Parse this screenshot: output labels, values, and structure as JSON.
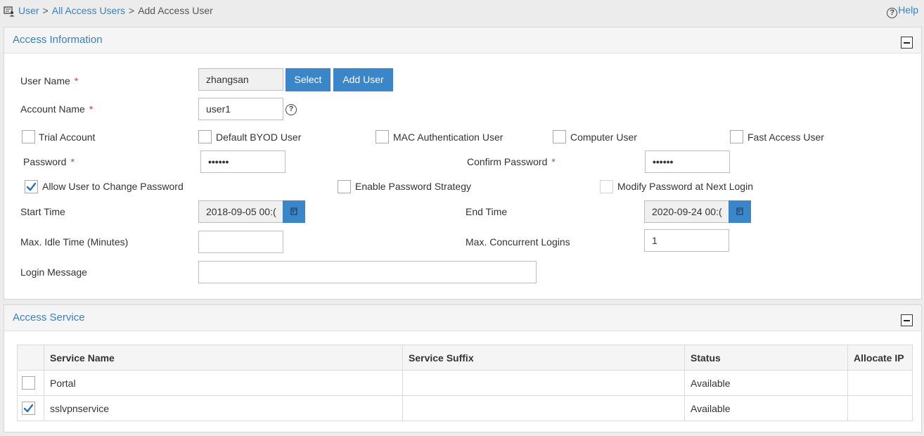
{
  "breadcrumb": {
    "items": [
      "User",
      "All Access Users"
    ],
    "separator": ">",
    "current": "Add Access User",
    "icon": "user-list-icon"
  },
  "help": {
    "label": "Help",
    "icon": "question-circle-icon"
  },
  "access_info": {
    "title": "Access Information",
    "user_name": {
      "label": "User Name",
      "value": "zhangsan"
    },
    "select_button": "Select",
    "add_user_button": "Add User",
    "account_name": {
      "label": "Account Name",
      "value": "user1"
    },
    "required_mark": "*",
    "checkboxes_row1": [
      {
        "label": "Trial Account",
        "checked": false
      },
      {
        "label": "Default BYOD User",
        "checked": false
      },
      {
        "label": "MAC Authentication User",
        "checked": false
      },
      {
        "label": "Computer User",
        "checked": false
      },
      {
        "label": "Fast Access User",
        "checked": false
      }
    ],
    "password": {
      "label": "Password",
      "value": "••••••"
    },
    "confirm_password": {
      "label": "Confirm Password",
      "value": "••••••"
    },
    "checkboxes_row2": [
      {
        "label": "Allow User to Change Password",
        "checked": true
      },
      {
        "label": "Enable Password Strategy",
        "checked": false
      },
      {
        "label": "Modify Password at Next Login",
        "checked": false
      }
    ],
    "start_time": {
      "label": "Start Time",
      "value": "2018-09-05 00:("
    },
    "end_time": {
      "label": "End Time",
      "value": "2020-09-24 00:("
    },
    "max_idle": {
      "label": "Max. Idle Time (Minutes)",
      "value": ""
    },
    "max_logins": {
      "label": "Max. Concurrent Logins",
      "value": "1"
    },
    "login_message": {
      "label": "Login Message",
      "value": ""
    }
  },
  "access_service": {
    "title": "Access Service",
    "columns": [
      "",
      "Service Name",
      "Service Suffix",
      "Status",
      "Allocate IP"
    ],
    "rows": [
      {
        "checked": false,
        "name": "Portal",
        "suffix": "",
        "status": "Available",
        "allocate_ip": ""
      },
      {
        "checked": true,
        "name": "sslvpnservice",
        "suffix": "",
        "status": "Available",
        "allocate_ip": ""
      }
    ]
  },
  "colors": {
    "accent": "#3a86c8",
    "link": "#3a7fc1",
    "required": "#e23b3b"
  }
}
